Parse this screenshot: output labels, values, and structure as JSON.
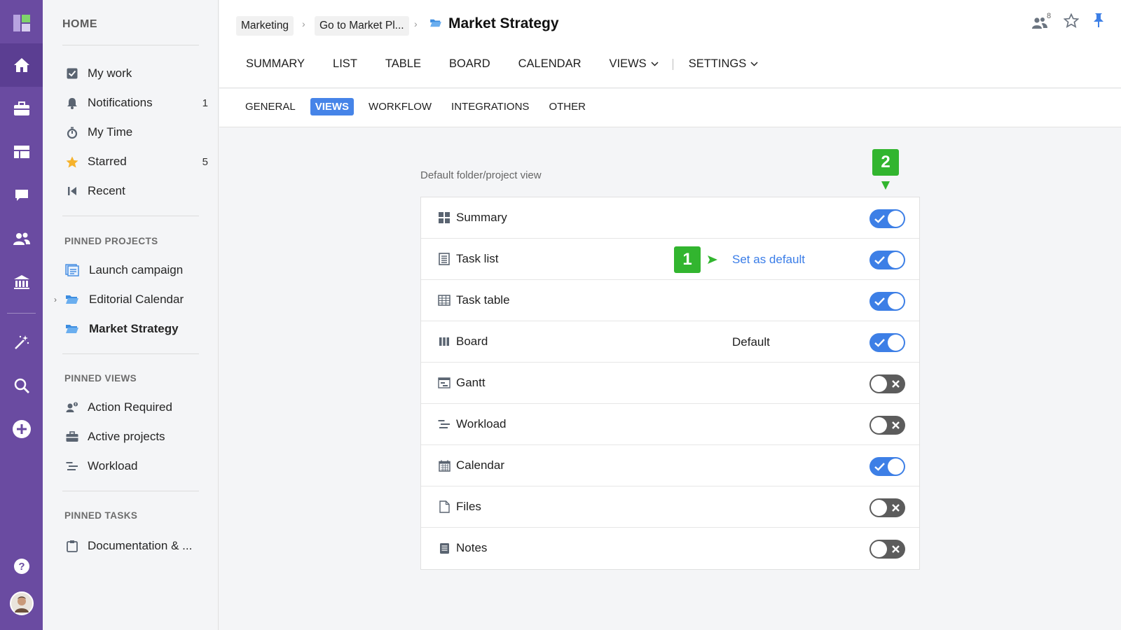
{
  "colors": {
    "rail": "#6a4ba1",
    "accent": "#3d7fe6",
    "toggle_off": "#5c5c5c",
    "annotation": "#32b52f"
  },
  "rail": {
    "items": [
      "logo-icon",
      "home-icon",
      "briefcase-icon",
      "dashboard-icon",
      "chat-icon",
      "people-icon",
      "bank-icon",
      "magic-wand-icon",
      "search-icon",
      "plus-icon",
      "help-icon",
      "avatar"
    ]
  },
  "sidebar": {
    "heading": "HOME",
    "items": [
      {
        "label": "My work",
        "icon": "checkbox-icon",
        "count": ""
      },
      {
        "label": "Notifications",
        "icon": "bell-icon",
        "count": "1"
      },
      {
        "label": "My Time",
        "icon": "stopwatch-icon",
        "count": ""
      },
      {
        "label": "Starred",
        "icon": "star-icon",
        "count": "5"
      },
      {
        "label": "Recent",
        "icon": "recent-icon",
        "count": ""
      }
    ],
    "pinned_projects": {
      "heading": "PINNED PROJECTS",
      "items": [
        {
          "label": "Launch campaign",
          "icon": "project-icon"
        },
        {
          "label": "Editorial Calendar",
          "icon": "folder-icon"
        },
        {
          "label": "Market Strategy",
          "icon": "folder-icon"
        }
      ]
    },
    "pinned_views": {
      "heading": "PINNED VIEWS",
      "items": [
        {
          "label": "Action Required",
          "icon": "person-alert-icon"
        },
        {
          "label": "Active projects",
          "icon": "briefcase-icon"
        },
        {
          "label": "Workload",
          "icon": "workload-icon"
        }
      ]
    },
    "pinned_tasks": {
      "heading": "PINNED TASKS",
      "items": [
        {
          "label": "Documentation & ...",
          "icon": "clipboard-icon"
        }
      ]
    }
  },
  "header": {
    "breadcrumb": [
      "Marketing",
      "Go to Market Pl..."
    ],
    "title": "Market Strategy",
    "members_count": "8",
    "tabs": [
      "SUMMARY",
      "LIST",
      "TABLE",
      "BOARD",
      "CALENDAR",
      "VIEWS",
      "SETTINGS"
    ],
    "subtabs": [
      "GENERAL",
      "VIEWS",
      "WORKFLOW",
      "INTEGRATIONS",
      "OTHER"
    ],
    "active_subtab": "VIEWS"
  },
  "views_panel": {
    "label": "Default folder/project view",
    "rows": [
      {
        "label": "Summary",
        "icon": "grid-icon",
        "enabled": true,
        "status": ""
      },
      {
        "label": "Task list",
        "icon": "list-icon",
        "enabled": true,
        "status": "Set as default"
      },
      {
        "label": "Task table",
        "icon": "table-icon",
        "enabled": true,
        "status": ""
      },
      {
        "label": "Board",
        "icon": "board-icon",
        "enabled": true,
        "status": "Default"
      },
      {
        "label": "Gantt",
        "icon": "gantt-icon",
        "enabled": false,
        "status": ""
      },
      {
        "label": "Workload",
        "icon": "workload-icon",
        "enabled": false,
        "status": ""
      },
      {
        "label": "Calendar",
        "icon": "calendar-icon",
        "enabled": true,
        "status": ""
      },
      {
        "label": "Files",
        "icon": "file-icon",
        "enabled": false,
        "status": ""
      },
      {
        "label": "Notes",
        "icon": "notes-icon",
        "enabled": false,
        "status": ""
      }
    ]
  },
  "annotations": [
    {
      "number": "1"
    },
    {
      "number": "2"
    }
  ]
}
